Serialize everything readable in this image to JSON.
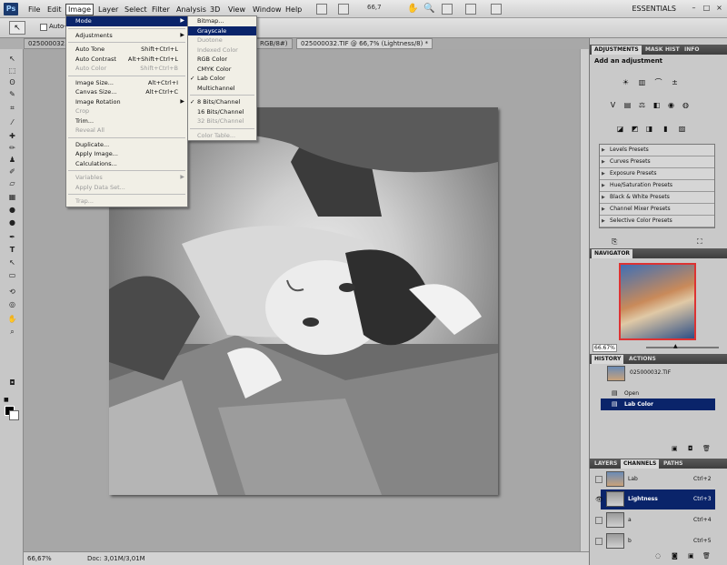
{
  "menubar": {
    "logo": "Ps",
    "items": [
      "File",
      "Edit",
      "Image",
      "Layer",
      "Select",
      "Filter",
      "Analysis",
      "3D",
      "View",
      "Window",
      "Help"
    ],
    "zoom": "66,7",
    "workspace": "ESSENTIALS"
  },
  "options": {
    "auto_label": "Auto-S"
  },
  "tabs": [
    {
      "label": "025000032..."
    },
    {
      "label": "RGB/8#)"
    },
    {
      "label": "025000032.TIF @ 66,7% (Lightness/8) *"
    }
  ],
  "image_menu": {
    "items": [
      {
        "label": "Mode",
        "submenu": true,
        "highlight": true
      },
      {
        "sep": true
      },
      {
        "label": "Adjustments",
        "submenu": true
      },
      {
        "sep": true
      },
      {
        "label": "Auto Tone",
        "shortcut": "Shift+Ctrl+L"
      },
      {
        "label": "Auto Contrast",
        "shortcut": "Alt+Shift+Ctrl+L"
      },
      {
        "label": "Auto Color",
        "shortcut": "Shift+Ctrl+B",
        "disabled": true
      },
      {
        "sep": true
      },
      {
        "label": "Image Size...",
        "shortcut": "Alt+Ctrl+I"
      },
      {
        "label": "Canvas Size...",
        "shortcut": "Alt+Ctrl+C"
      },
      {
        "label": "Image Rotation",
        "submenu": true
      },
      {
        "label": "Crop",
        "disabled": true
      },
      {
        "label": "Trim..."
      },
      {
        "label": "Reveal All",
        "disabled": true
      },
      {
        "sep": true
      },
      {
        "label": "Duplicate..."
      },
      {
        "label": "Apply Image..."
      },
      {
        "label": "Calculations..."
      },
      {
        "sep": true
      },
      {
        "label": "Variables",
        "submenu": true,
        "disabled": true
      },
      {
        "label": "Apply Data Set...",
        "disabled": true
      },
      {
        "sep": true
      },
      {
        "label": "Trap...",
        "disabled": true
      }
    ]
  },
  "mode_menu": {
    "items": [
      {
        "label": "Bitmap..."
      },
      {
        "label": "Grayscale",
        "highlight": true
      },
      {
        "label": "Duotone",
        "disabled": true
      },
      {
        "label": "Indexed Color",
        "disabled": true
      },
      {
        "label": "RGB Color"
      },
      {
        "label": "CMYK Color"
      },
      {
        "label": "Lab Color",
        "checked": true
      },
      {
        "label": "Multichannel"
      },
      {
        "sep": true
      },
      {
        "label": "8 Bits/Channel",
        "checked": true
      },
      {
        "label": "16 Bits/Channel"
      },
      {
        "label": "32 Bits/Channel",
        "disabled": true
      },
      {
        "sep": true
      },
      {
        "label": "Color Table...",
        "disabled": true
      }
    ]
  },
  "adjustments": {
    "tabs": [
      "ADJUSTMENTS",
      "MASK",
      "HIST",
      "INFO"
    ],
    "title": "Add an adjustment",
    "presets": [
      "Levels Presets",
      "Curves Presets",
      "Exposure Presets",
      "Hue/Saturation Presets",
      "Black & White Presets",
      "Channel Mixer Presets",
      "Selective Color Presets"
    ]
  },
  "navigator": {
    "tab": "NAVIGATOR",
    "zoom": "66.67%"
  },
  "history": {
    "tabs": [
      "HISTORY",
      "ACTIONS"
    ],
    "snapshot": "025000032.TIF",
    "steps": [
      "Open",
      "Lab Color"
    ]
  },
  "channels": {
    "tabs": [
      "LAYERS",
      "CHANNELS",
      "PATHS"
    ],
    "rows": [
      {
        "name": "Lab",
        "shortcut": "Ctrl+2"
      },
      {
        "name": "Lightness",
        "shortcut": "Ctrl+3"
      },
      {
        "name": "a",
        "shortcut": "Ctrl+4"
      },
      {
        "name": "b",
        "shortcut": "Ctrl+5"
      }
    ]
  },
  "status": {
    "zoom": "66,67%",
    "doc": "Doc: 3,01M/3,01M"
  }
}
